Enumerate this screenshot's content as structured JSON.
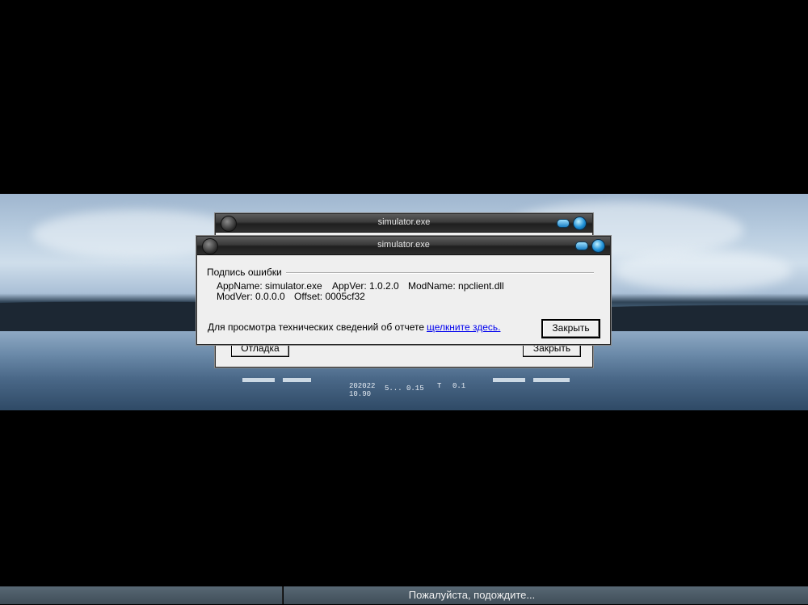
{
  "background": {
    "overlay_line1": "202022",
    "overlay_line2": "10.90",
    "overlay_mid": "5... 0.15",
    "overlay_t": "T",
    "overlay_v": "0.1"
  },
  "back_dialog": {
    "title": "simulator.exe",
    "debug_button": "Отладка",
    "close_button": "Закрыть"
  },
  "front_dialog": {
    "title": "simulator.exe",
    "group_label": "Подпись ошибки",
    "app_name": "AppName: simulator.exe",
    "app_ver": "AppVer: 1.0.2.0",
    "mod_name": "ModName: npclient.dll",
    "mod_ver": "ModVer: 0.0.0.0",
    "offset": "Offset: 0005cf32",
    "details_text": "Для просмотра технических сведений об отчете",
    "details_link": "щелкните здесь.",
    "close_button": "Закрыть"
  },
  "status": {
    "message": "Пожалуйста, подождите..."
  },
  "colors": {
    "title_bar": "#2e2e2e",
    "dialog_bg": "#efefef",
    "accent_blue": "#1e8fd6",
    "status_bar": "#4a5963"
  }
}
